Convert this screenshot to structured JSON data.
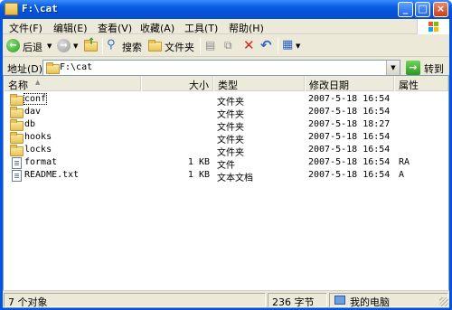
{
  "window": {
    "title": "F:\\cat"
  },
  "menu": [
    {
      "label": "文件(F)"
    },
    {
      "label": "编辑(E)"
    },
    {
      "label": "查看(V)"
    },
    {
      "label": "收藏(A)"
    },
    {
      "label": "工具(T)"
    },
    {
      "label": "帮助(H)"
    }
  ],
  "toolbar": {
    "back_label": "后退",
    "search_label": "搜索",
    "folders_label": "文件夹"
  },
  "address": {
    "label": "地址(D)",
    "value": "F:\\cat",
    "go_label": "转到"
  },
  "columns": {
    "name": "名称",
    "size": "大小",
    "type": "类型",
    "modified": "修改日期",
    "attributes": "属性"
  },
  "files": [
    {
      "name": "conf",
      "size": "",
      "type": "文件夹",
      "modified": "2007-5-18 16:54",
      "attr": "",
      "icon": "folder-icon"
    },
    {
      "name": "dav",
      "size": "",
      "type": "文件夹",
      "modified": "2007-5-18 16:54",
      "attr": "",
      "icon": "folder-icon"
    },
    {
      "name": "db",
      "size": "",
      "type": "文件夹",
      "modified": "2007-5-18 18:27",
      "attr": "",
      "icon": "folder-icon"
    },
    {
      "name": "hooks",
      "size": "",
      "type": "文件夹",
      "modified": "2007-5-18 16:54",
      "attr": "",
      "icon": "folder-icon"
    },
    {
      "name": "locks",
      "size": "",
      "type": "文件夹",
      "modified": "2007-5-18 16:54",
      "attr": "",
      "icon": "folder-icon"
    },
    {
      "name": "format",
      "size": "1 KB",
      "type": "文件",
      "modified": "2007-5-18 16:54",
      "attr": "RA",
      "icon": "file-icon"
    },
    {
      "name": "README.txt",
      "size": "1 KB",
      "type": "文本文档",
      "modified": "2007-5-18 16:54",
      "attr": "A",
      "icon": "text-file-icon"
    }
  ],
  "status": {
    "objects": "7 个对象",
    "bytes": "236 字节",
    "location": "我的电脑"
  },
  "colors": {
    "titlebar": "#0054e3",
    "face": "#ece9d8"
  }
}
